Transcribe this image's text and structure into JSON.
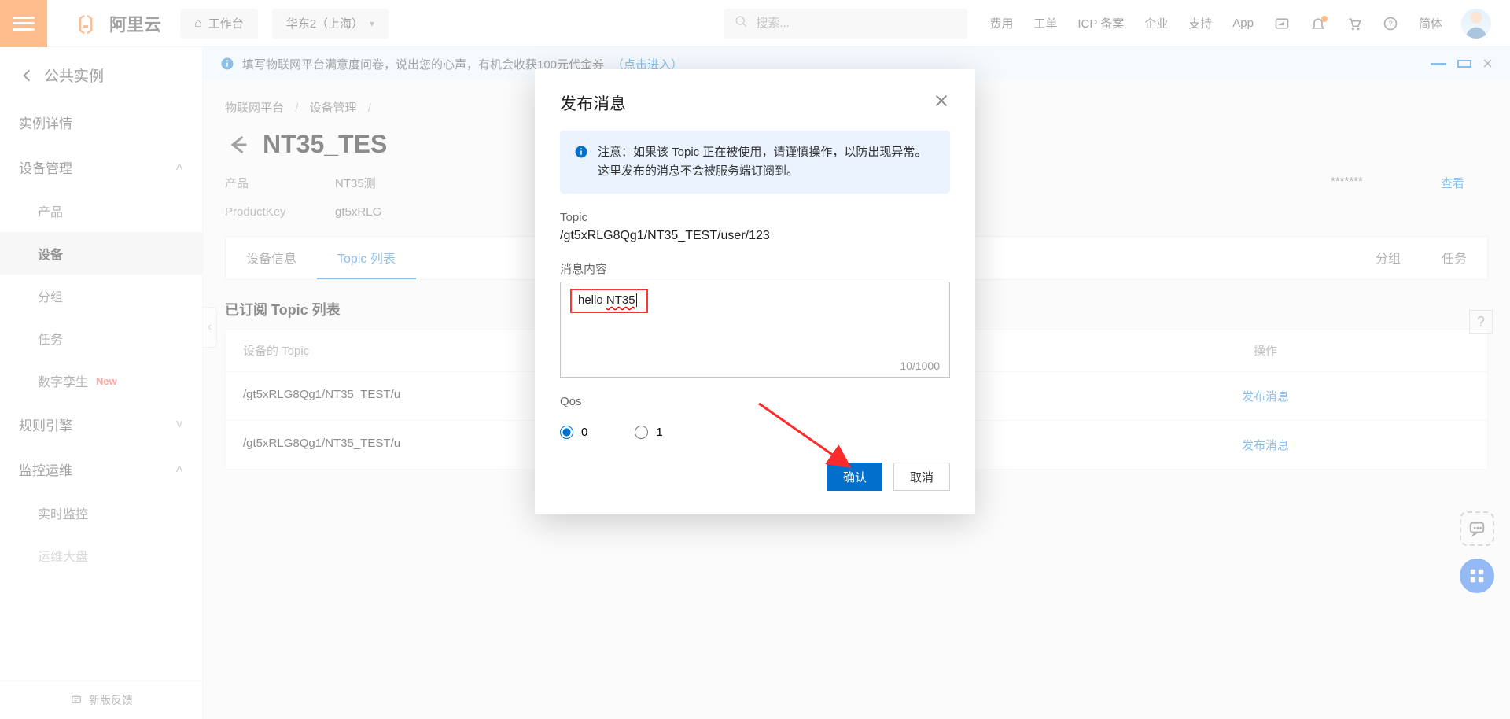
{
  "header": {
    "logo_text": "阿里云",
    "workbench": "工作台",
    "region": "华东2（上海）",
    "search_placeholder": "搜索...",
    "links": [
      "费用",
      "工单",
      "ICP 备案",
      "企业",
      "支持",
      "App"
    ],
    "lang": "简体"
  },
  "sidebar": {
    "back_label": "公共实例",
    "items": [
      {
        "label": "实例详情"
      },
      {
        "label": "设备管理",
        "expanded": true,
        "children": [
          {
            "label": "产品"
          },
          {
            "label": "设备",
            "active": true
          },
          {
            "label": "分组"
          },
          {
            "label": "任务"
          },
          {
            "label": "数字孪生",
            "new_tag": "New"
          }
        ]
      },
      {
        "label": "规则引擎",
        "expanded": false
      },
      {
        "label": "监控运维",
        "expanded": true,
        "children": [
          {
            "label": "实时监控"
          },
          {
            "label": "运维大盘"
          }
        ]
      }
    ],
    "footer": "新版反馈"
  },
  "main": {
    "banner_text": "填写物联网平台满意度问卷，说出您的心声，有机会收获100元代金券",
    "banner_link": "（点击进入）",
    "breadcrumbs": [
      "物联网平台",
      "设备管理"
    ],
    "device_title": "NT35_TES",
    "meta": {
      "product_label": "产品",
      "product_value": "NT35测",
      "device_secret_masked": "*******",
      "view": "查看",
      "productkey_label": "ProductKey",
      "productkey_value": "gt5xRLG"
    },
    "tabs": [
      "设备信息",
      "Topic 列表",
      "分组",
      "任务"
    ],
    "section_title": "已订阅 Topic 列表",
    "table": {
      "cols": [
        "设备的 Topic",
        "操作"
      ],
      "rows": [
        {
          "topic": "/gt5xRLG8Qg1/NT35_TEST/u",
          "action": "发布消息"
        },
        {
          "topic": "/gt5xRLG8Qg1/NT35_TEST/u",
          "action": "发布消息"
        }
      ]
    },
    "help_tooltip": "?"
  },
  "modal": {
    "title": "发布消息",
    "note": "注意：如果该 Topic 正在被使用，请谨慎操作，以防出现异常。这里发布的消息不会被服务端订阅到。",
    "topic_label": "Topic",
    "topic_value": "/gt5xRLG8Qg1/NT35_TEST/user/123",
    "message_label": "消息内容",
    "message_value_prefix": "hello ",
    "message_value_underlined": "NT35",
    "counter": "10/1000",
    "qos_label": "Qos",
    "qos_options": [
      "0",
      "1"
    ],
    "qos_selected": "0",
    "confirm": "确认",
    "cancel": "取消"
  }
}
